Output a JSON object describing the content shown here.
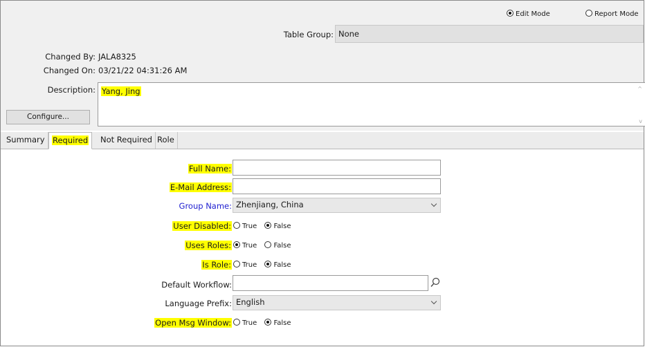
{
  "mode": {
    "edit_label": "Edit Mode",
    "report_label": "Report Mode",
    "selected": "Edit Mode"
  },
  "table_group": {
    "label": "Table Group:",
    "value": "None"
  },
  "changed_by": {
    "label": "Changed By:",
    "value": "JALA8325"
  },
  "changed_on": {
    "label": "Changed On:",
    "value": "03/21/22 04:31:26 AM"
  },
  "description": {
    "label": "Description:",
    "value": "Yang, Jing"
  },
  "configure_button": "Configure...",
  "tabs": [
    {
      "label": "Summary",
      "active": false
    },
    {
      "label": "Required",
      "active": true
    },
    {
      "label": "Not Required",
      "active": false
    },
    {
      "label": "Role",
      "active": false
    }
  ],
  "form": {
    "full_name": {
      "label": "Full Name:",
      "value": ""
    },
    "email": {
      "label": "E-Mail Address:",
      "value": ""
    },
    "group_name": {
      "label": "Group Name:",
      "value": "Zhenjiang, China"
    },
    "user_disabled": {
      "label": "User Disabled:",
      "selected": "False"
    },
    "uses_roles": {
      "label": "Uses Roles:",
      "selected": "True"
    },
    "is_role": {
      "label": "Is Role:",
      "selected": "False"
    },
    "default_workflow": {
      "label": "Default Workflow:",
      "value": ""
    },
    "language_prefix": {
      "label": "Language Prefix:",
      "value": "English"
    },
    "open_msg_window": {
      "label": "Open Msg Window:",
      "selected": "False"
    },
    "true_label": "True",
    "false_label": "False"
  },
  "colors": {
    "highlight": "#ffff00",
    "link_label": "#2020d0",
    "panel": "#f0f0f0"
  }
}
